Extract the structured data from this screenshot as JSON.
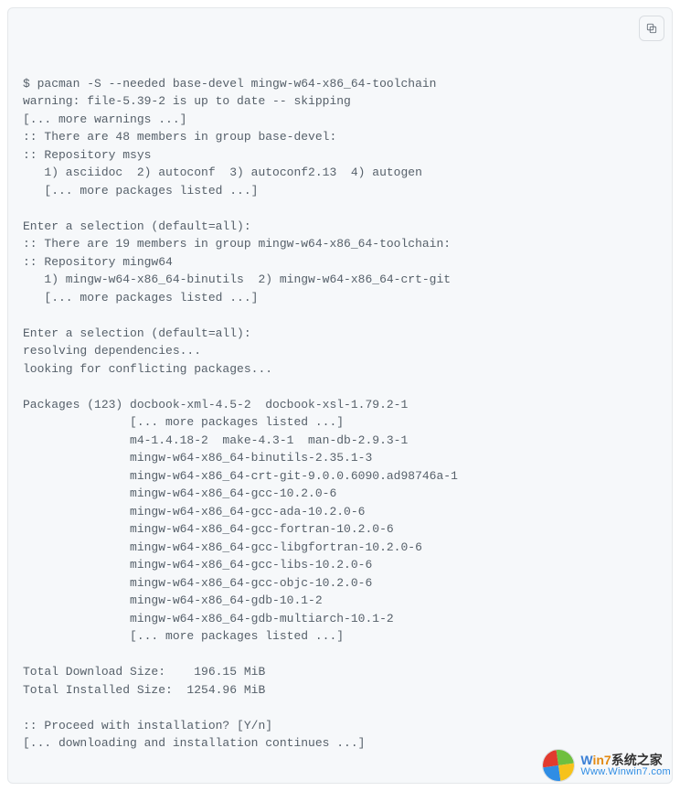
{
  "code": {
    "lines": [
      "$ pacman -S --needed base-devel mingw-w64-x86_64-toolchain",
      "warning: file-5.39-2 is up to date -- skipping",
      "[... more warnings ...]",
      ":: There are 48 members in group base-devel:",
      ":: Repository msys",
      "   1) asciidoc  2) autoconf  3) autoconf2.13  4) autogen",
      "   [... more packages listed ...]",
      "",
      "Enter a selection (default=all):",
      ":: There are 19 members in group mingw-w64-x86_64-toolchain:",
      ":: Repository mingw64",
      "   1) mingw-w64-x86_64-binutils  2) mingw-w64-x86_64-crt-git",
      "   [... more packages listed ...]",
      "",
      "Enter a selection (default=all):",
      "resolving dependencies...",
      "looking for conflicting packages...",
      "",
      "Packages (123) docbook-xml-4.5-2  docbook-xsl-1.79.2-1",
      "               [... more packages listed ...]",
      "               m4-1.4.18-2  make-4.3-1  man-db-2.9.3-1",
      "               mingw-w64-x86_64-binutils-2.35.1-3",
      "               mingw-w64-x86_64-crt-git-9.0.0.6090.ad98746a-1",
      "               mingw-w64-x86_64-gcc-10.2.0-6",
      "               mingw-w64-x86_64-gcc-ada-10.2.0-6",
      "               mingw-w64-x86_64-gcc-fortran-10.2.0-6",
      "               mingw-w64-x86_64-gcc-libgfortran-10.2.0-6",
      "               mingw-w64-x86_64-gcc-libs-10.2.0-6",
      "               mingw-w64-x86_64-gcc-objc-10.2.0-6",
      "               mingw-w64-x86_64-gdb-10.1-2",
      "               mingw-w64-x86_64-gdb-multiarch-10.1-2",
      "               [... more packages listed ...]",
      "",
      "Total Download Size:    196.15 MiB",
      "Total Installed Size:  1254.96 MiB",
      "",
      ":: Proceed with installation? [Y/n]",
      "[... downloading and installation continues ...]"
    ]
  },
  "watermark": {
    "brand_w": "W",
    "brand_in7": "in7",
    "brand_rest": "系统之家",
    "url": "Www.Winwin7.com"
  }
}
